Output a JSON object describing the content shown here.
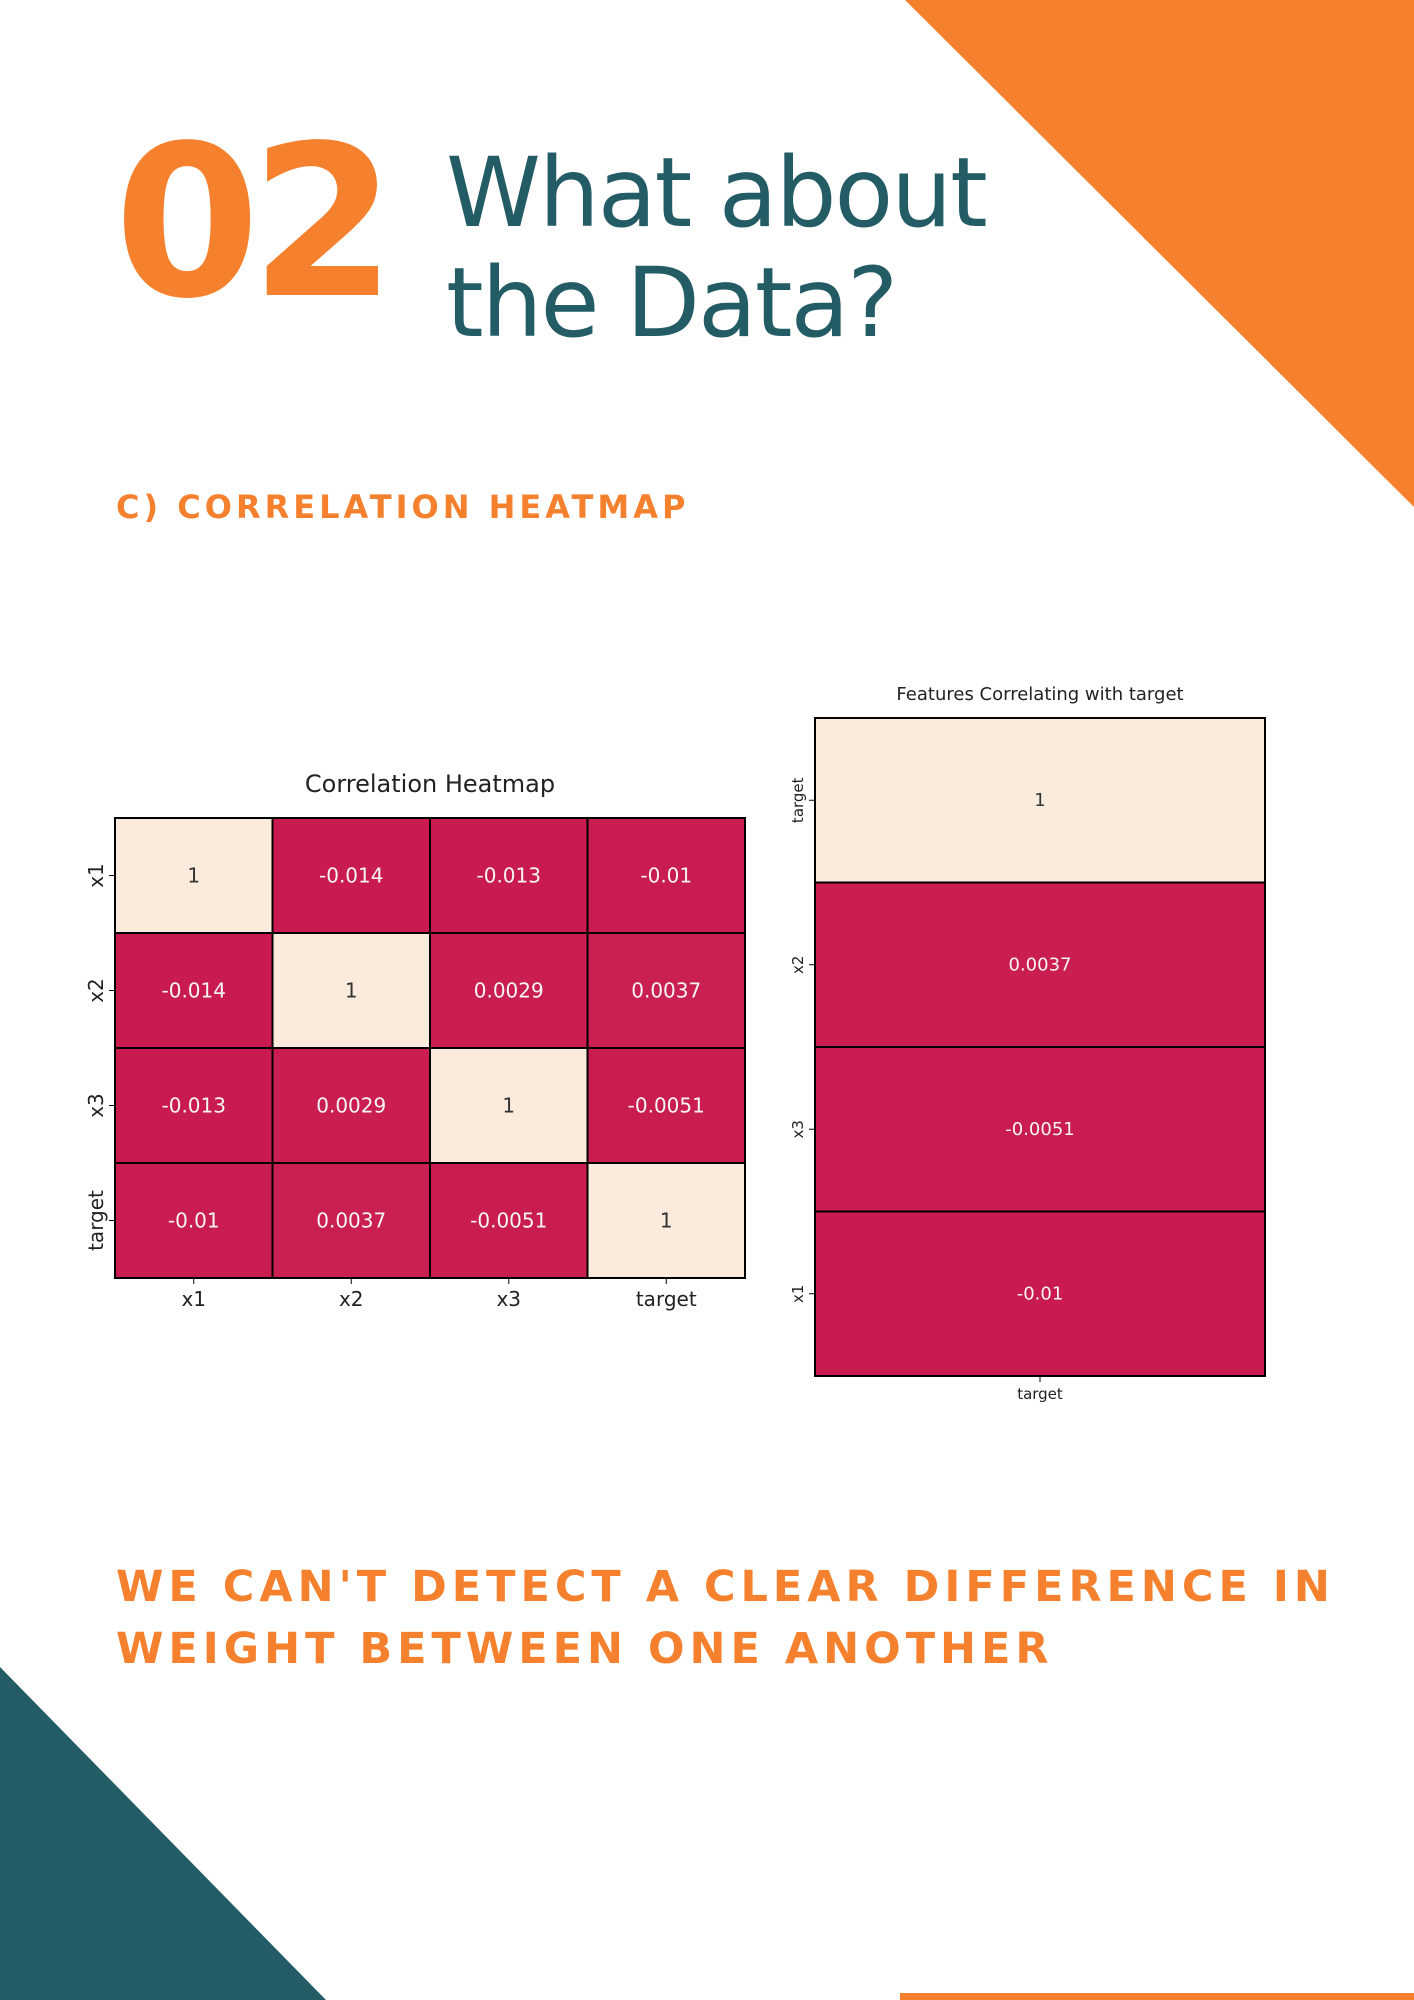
{
  "section_number": "02",
  "headline": "What about the Data?",
  "section_label": "C) CORRELATION HEATMAP",
  "conclusion": "WE CAN'T DETECT A CLEAR DIFFERENCE IN WEIGHT BETWEEN ONE ANOTHER",
  "colors": {
    "accent_orange": "#f5802d",
    "accent_teal": "#235c65",
    "heat_high": "#faebdc",
    "heat_low": "#c91b4f"
  },
  "chart_data": [
    {
      "type": "heatmap",
      "title": "Correlation Heatmap",
      "x": [
        "x1",
        "x2",
        "x3",
        "target"
      ],
      "y": [
        "x1",
        "x2",
        "x3",
        "target"
      ],
      "values": [
        [
          1,
          -0.014,
          -0.013,
          -0.01
        ],
        [
          -0.014,
          1,
          0.0029,
          0.0037
        ],
        [
          -0.013,
          0.0029,
          1,
          -0.0051
        ],
        [
          -0.01,
          0.0037,
          -0.0051,
          1
        ]
      ],
      "colorbar": false
    },
    {
      "type": "heatmap",
      "title": "Features Correlating with target",
      "x": [
        "target"
      ],
      "y": [
        "target",
        "x2",
        "x3",
        "x1"
      ],
      "values": [
        [
          1
        ],
        [
          0.0037
        ],
        [
          -0.0051
        ],
        [
          -0.01
        ]
      ],
      "colorbar": false
    }
  ]
}
